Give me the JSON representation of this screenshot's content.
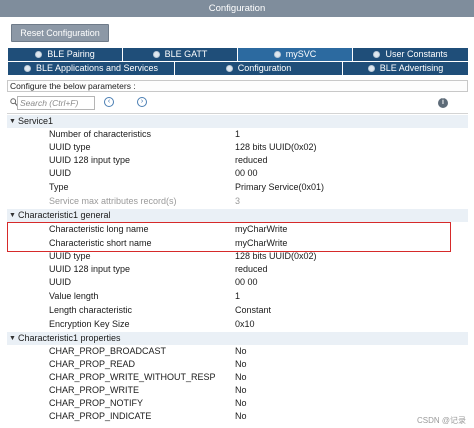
{
  "window": {
    "title": "Configuration"
  },
  "toolbar": {
    "reset_label": "Reset Configuration"
  },
  "tabs_row1": [
    {
      "label": "BLE Pairing",
      "active": false
    },
    {
      "label": "BLE GATT",
      "active": false
    },
    {
      "label": "mySVC",
      "active": true
    },
    {
      "label": "User Constants",
      "active": false
    }
  ],
  "tabs_row2": [
    {
      "label": "BLE Applications and Services",
      "active": false
    },
    {
      "label": "Configuration",
      "active": false
    },
    {
      "label": "BLE Advertising",
      "active": false
    }
  ],
  "hint": "Configure the below parameters :",
  "search": {
    "placeholder": "Search (Ctrl+F)"
  },
  "icons": {
    "search": "search-icon",
    "prev": "arrow-left-icon",
    "next": "arrow-right-icon",
    "info": "info-icon",
    "collapse": "chevron-down-icon"
  },
  "groups": [
    {
      "name": "Service1",
      "params": [
        {
          "name": "Number of characteristics",
          "value": "1",
          "disabled": false
        },
        {
          "name": "UUID type",
          "value": "128 bits UUID(0x02)",
          "disabled": false
        },
        {
          "name": "UUID 128 input type",
          "value": "reduced",
          "disabled": false
        },
        {
          "name": "UUID",
          "value": "00 00",
          "disabled": false
        },
        {
          "name": "Type",
          "value": "Primary Service(0x01)",
          "disabled": false
        },
        {
          "name": "Service max attributes record(s)",
          "value": "3",
          "disabled": true
        }
      ]
    },
    {
      "name": "Characteristic1 general",
      "params": [
        {
          "name": "Characteristic long name",
          "value": "myCharWrite",
          "disabled": false
        },
        {
          "name": "Characteristic short name",
          "value": "myCharWrite",
          "disabled": false
        },
        {
          "name": "UUID type",
          "value": "128 bits UUID(0x02)",
          "disabled": false
        },
        {
          "name": "UUID 128 input type",
          "value": "reduced",
          "disabled": false
        },
        {
          "name": "UUID",
          "value": "00 00",
          "disabled": false
        },
        {
          "name": "Value length",
          "value": "1",
          "disabled": false
        },
        {
          "name": "Length characteristic",
          "value": "Constant",
          "disabled": false
        },
        {
          "name": "Encryption Key Size",
          "value": "0x10",
          "disabled": false
        }
      ]
    },
    {
      "name": "Characteristic1 properties",
      "params": [
        {
          "name": "CHAR_PROP_BROADCAST",
          "value": "No",
          "disabled": false
        },
        {
          "name": "CHAR_PROP_READ",
          "value": "No",
          "disabled": false
        },
        {
          "name": "CHAR_PROP_WRITE_WITHOUT_RESP",
          "value": "No",
          "disabled": false
        },
        {
          "name": "CHAR_PROP_WRITE",
          "value": "No",
          "disabled": false
        },
        {
          "name": "CHAR_PROP_NOTIFY",
          "value": "No",
          "disabled": false
        },
        {
          "name": "CHAR_PROP_INDICATE",
          "value": "No",
          "disabled": false
        }
      ]
    }
  ],
  "watermark": "CSDN @记录",
  "colors": {
    "tab_bg": "#1f4e79",
    "highlight": "#d62a2a",
    "group_bg": "#eaf0f6"
  }
}
